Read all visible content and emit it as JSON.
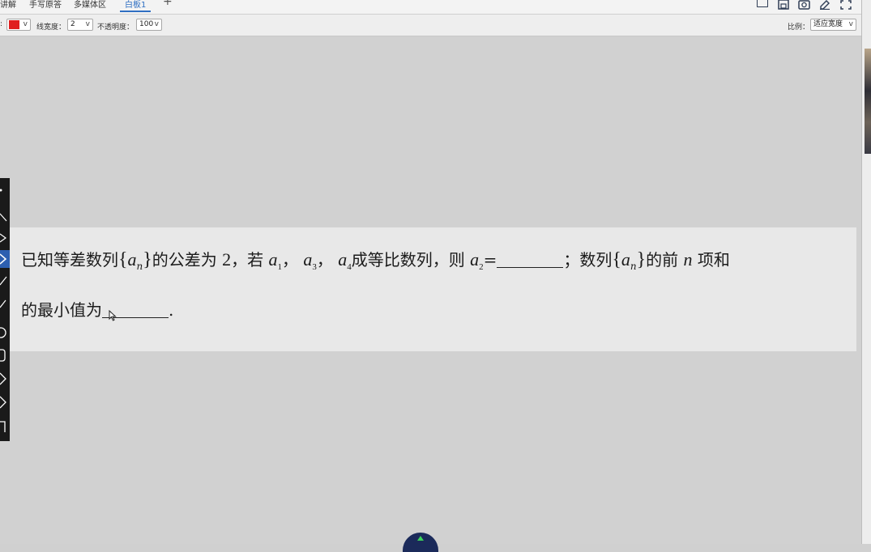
{
  "tabs": [
    {
      "label": "讲解",
      "active": false
    },
    {
      "label": "手写原答",
      "active": false
    },
    {
      "label": "多媒体区",
      "active": false
    },
    {
      "label": "白板1",
      "active": true
    }
  ],
  "tab_add": "+",
  "options": {
    "line_width_label": "线宽度：",
    "line_width_value": "2",
    "opacity_label": "不透明度：",
    "opacity_value": "100",
    "scale_label": "比例：",
    "scale_value": "适应宽度",
    "pen_color": "#e02020",
    "caret": "v"
  },
  "problem": {
    "p1": "已知等差数列",
    "p2": "的公差为",
    "p3": "2",
    "p4": "，若",
    "p5": "，",
    "p6": "，",
    "p7": "成等比数列，则",
    "p8": "=",
    "p9": "；数列",
    "p10": "的前",
    "p11": "n",
    "p12": "项和",
    "p13": "的最小值为",
    "p14": ".",
    "var_a": "a",
    "sub_n": "n",
    "sub_1": "1",
    "sub_3": "3",
    "sub_4": "4",
    "sub_2": "2",
    "brace_open": "{",
    "brace_close": "}"
  },
  "icons": [
    "window-icon",
    "save-icon",
    "camera-icon",
    "edit-icon",
    "fullscreen-icon",
    "cursor-icon",
    "left-tool-icons"
  ]
}
